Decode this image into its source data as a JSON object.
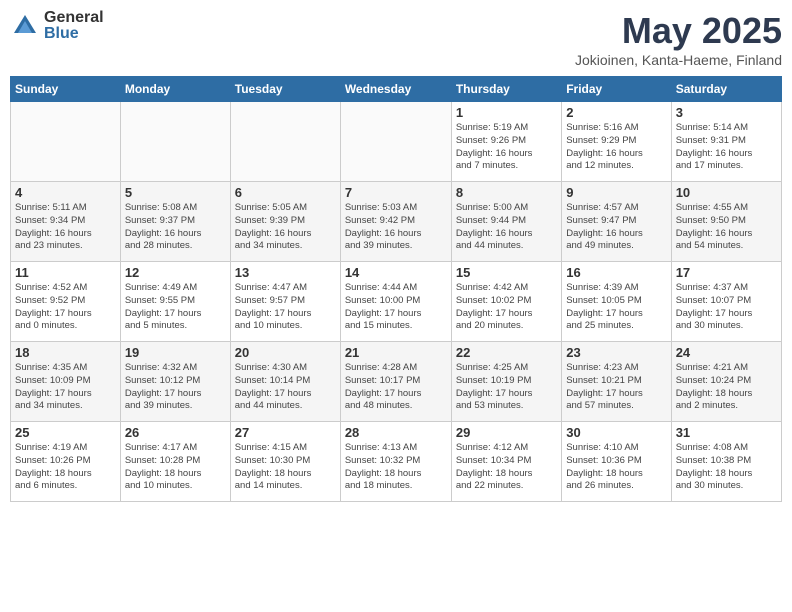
{
  "logo": {
    "general": "General",
    "blue": "Blue"
  },
  "title": {
    "month": "May 2025",
    "location": "Jokioinen, Kanta-Haeme, Finland"
  },
  "days_of_week": [
    "Sunday",
    "Monday",
    "Tuesday",
    "Wednesday",
    "Thursday",
    "Friday",
    "Saturday"
  ],
  "weeks": [
    [
      {
        "num": "",
        "info": ""
      },
      {
        "num": "",
        "info": ""
      },
      {
        "num": "",
        "info": ""
      },
      {
        "num": "",
        "info": ""
      },
      {
        "num": "1",
        "info": "Sunrise: 5:19 AM\nSunset: 9:26 PM\nDaylight: 16 hours\nand 7 minutes."
      },
      {
        "num": "2",
        "info": "Sunrise: 5:16 AM\nSunset: 9:29 PM\nDaylight: 16 hours\nand 12 minutes."
      },
      {
        "num": "3",
        "info": "Sunrise: 5:14 AM\nSunset: 9:31 PM\nDaylight: 16 hours\nand 17 minutes."
      }
    ],
    [
      {
        "num": "4",
        "info": "Sunrise: 5:11 AM\nSunset: 9:34 PM\nDaylight: 16 hours\nand 23 minutes."
      },
      {
        "num": "5",
        "info": "Sunrise: 5:08 AM\nSunset: 9:37 PM\nDaylight: 16 hours\nand 28 minutes."
      },
      {
        "num": "6",
        "info": "Sunrise: 5:05 AM\nSunset: 9:39 PM\nDaylight: 16 hours\nand 34 minutes."
      },
      {
        "num": "7",
        "info": "Sunrise: 5:03 AM\nSunset: 9:42 PM\nDaylight: 16 hours\nand 39 minutes."
      },
      {
        "num": "8",
        "info": "Sunrise: 5:00 AM\nSunset: 9:44 PM\nDaylight: 16 hours\nand 44 minutes."
      },
      {
        "num": "9",
        "info": "Sunrise: 4:57 AM\nSunset: 9:47 PM\nDaylight: 16 hours\nand 49 minutes."
      },
      {
        "num": "10",
        "info": "Sunrise: 4:55 AM\nSunset: 9:50 PM\nDaylight: 16 hours\nand 54 minutes."
      }
    ],
    [
      {
        "num": "11",
        "info": "Sunrise: 4:52 AM\nSunset: 9:52 PM\nDaylight: 17 hours\nand 0 minutes."
      },
      {
        "num": "12",
        "info": "Sunrise: 4:49 AM\nSunset: 9:55 PM\nDaylight: 17 hours\nand 5 minutes."
      },
      {
        "num": "13",
        "info": "Sunrise: 4:47 AM\nSunset: 9:57 PM\nDaylight: 17 hours\nand 10 minutes."
      },
      {
        "num": "14",
        "info": "Sunrise: 4:44 AM\nSunset: 10:00 PM\nDaylight: 17 hours\nand 15 minutes."
      },
      {
        "num": "15",
        "info": "Sunrise: 4:42 AM\nSunset: 10:02 PM\nDaylight: 17 hours\nand 20 minutes."
      },
      {
        "num": "16",
        "info": "Sunrise: 4:39 AM\nSunset: 10:05 PM\nDaylight: 17 hours\nand 25 minutes."
      },
      {
        "num": "17",
        "info": "Sunrise: 4:37 AM\nSunset: 10:07 PM\nDaylight: 17 hours\nand 30 minutes."
      }
    ],
    [
      {
        "num": "18",
        "info": "Sunrise: 4:35 AM\nSunset: 10:09 PM\nDaylight: 17 hours\nand 34 minutes."
      },
      {
        "num": "19",
        "info": "Sunrise: 4:32 AM\nSunset: 10:12 PM\nDaylight: 17 hours\nand 39 minutes."
      },
      {
        "num": "20",
        "info": "Sunrise: 4:30 AM\nSunset: 10:14 PM\nDaylight: 17 hours\nand 44 minutes."
      },
      {
        "num": "21",
        "info": "Sunrise: 4:28 AM\nSunset: 10:17 PM\nDaylight: 17 hours\nand 48 minutes."
      },
      {
        "num": "22",
        "info": "Sunrise: 4:25 AM\nSunset: 10:19 PM\nDaylight: 17 hours\nand 53 minutes."
      },
      {
        "num": "23",
        "info": "Sunrise: 4:23 AM\nSunset: 10:21 PM\nDaylight: 17 hours\nand 57 minutes."
      },
      {
        "num": "24",
        "info": "Sunrise: 4:21 AM\nSunset: 10:24 PM\nDaylight: 18 hours\nand 2 minutes."
      }
    ],
    [
      {
        "num": "25",
        "info": "Sunrise: 4:19 AM\nSunset: 10:26 PM\nDaylight: 18 hours\nand 6 minutes."
      },
      {
        "num": "26",
        "info": "Sunrise: 4:17 AM\nSunset: 10:28 PM\nDaylight: 18 hours\nand 10 minutes."
      },
      {
        "num": "27",
        "info": "Sunrise: 4:15 AM\nSunset: 10:30 PM\nDaylight: 18 hours\nand 14 minutes."
      },
      {
        "num": "28",
        "info": "Sunrise: 4:13 AM\nSunset: 10:32 PM\nDaylight: 18 hours\nand 18 minutes."
      },
      {
        "num": "29",
        "info": "Sunrise: 4:12 AM\nSunset: 10:34 PM\nDaylight: 18 hours\nand 22 minutes."
      },
      {
        "num": "30",
        "info": "Sunrise: 4:10 AM\nSunset: 10:36 PM\nDaylight: 18 hours\nand 26 minutes."
      },
      {
        "num": "31",
        "info": "Sunrise: 4:08 AM\nSunset: 10:38 PM\nDaylight: 18 hours\nand 30 minutes."
      }
    ]
  ]
}
